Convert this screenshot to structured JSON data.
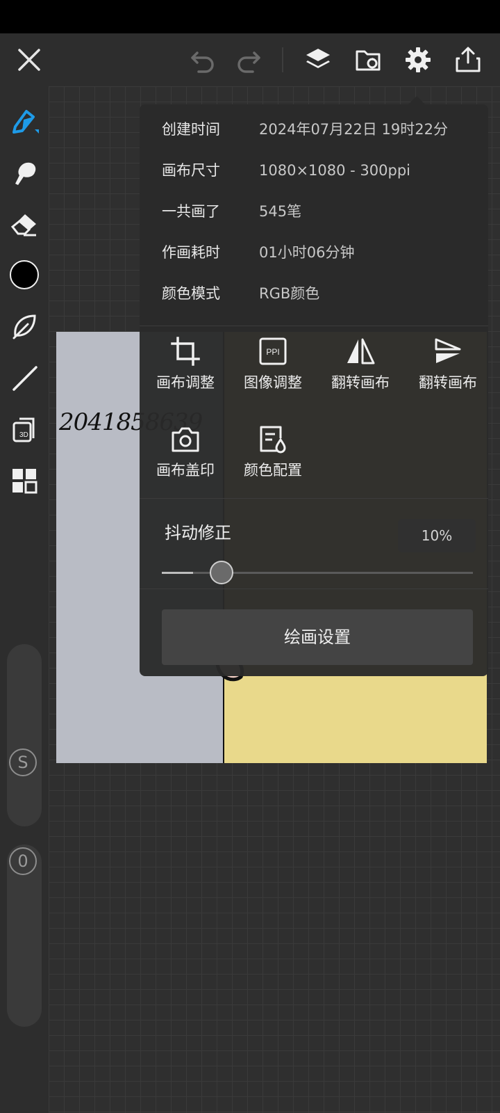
{
  "toolbar": {
    "icons": [
      "close-icon",
      "undo-icon",
      "redo-icon",
      "layers-icon",
      "import-icon",
      "gear-icon",
      "share-icon"
    ]
  },
  "sidebar": {
    "tools": [
      "brush-icon",
      "smudge-icon",
      "eraser-icon",
      "color-swatch",
      "leaf-icon",
      "line-icon",
      "3d-icon",
      "grid-icon"
    ],
    "current_color": "#000000",
    "accent": "#1e9be8",
    "size_label": "S",
    "opacity_label": "0"
  },
  "canvas": {
    "signature": "2041858639",
    "left_color": "#b9bcc5",
    "right_color": "#e9d98b"
  },
  "popup": {
    "info": [
      {
        "label": "创建时间",
        "value": "2024年07月22日 19时22分"
      },
      {
        "label": "画布尺寸",
        "value": "1080×1080 - 300ppi"
      },
      {
        "label": "一共画了",
        "value": "545笔"
      },
      {
        "label": "作画耗时",
        "value": "01小时06分钟"
      },
      {
        "label": "颜色模式",
        "value": "RGB颜色"
      }
    ],
    "actions": [
      {
        "label": "画布调整",
        "icon": "crop-icon"
      },
      {
        "label": "图像调整",
        "icon": "ppi-icon",
        "icon_text": "PPI"
      },
      {
        "label": "翻转画布",
        "icon": "flip-horizontal-icon"
      },
      {
        "label": "翻转画布",
        "icon": "flip-vertical-icon"
      },
      {
        "label": "画布盖印",
        "icon": "camera-icon"
      },
      {
        "label": "颜色配置",
        "icon": "color-profile-icon"
      }
    ],
    "jitter": {
      "label": "抖动修正",
      "value_text": "10%",
      "value": 0.1
    },
    "settings_button": "绘画设置"
  }
}
